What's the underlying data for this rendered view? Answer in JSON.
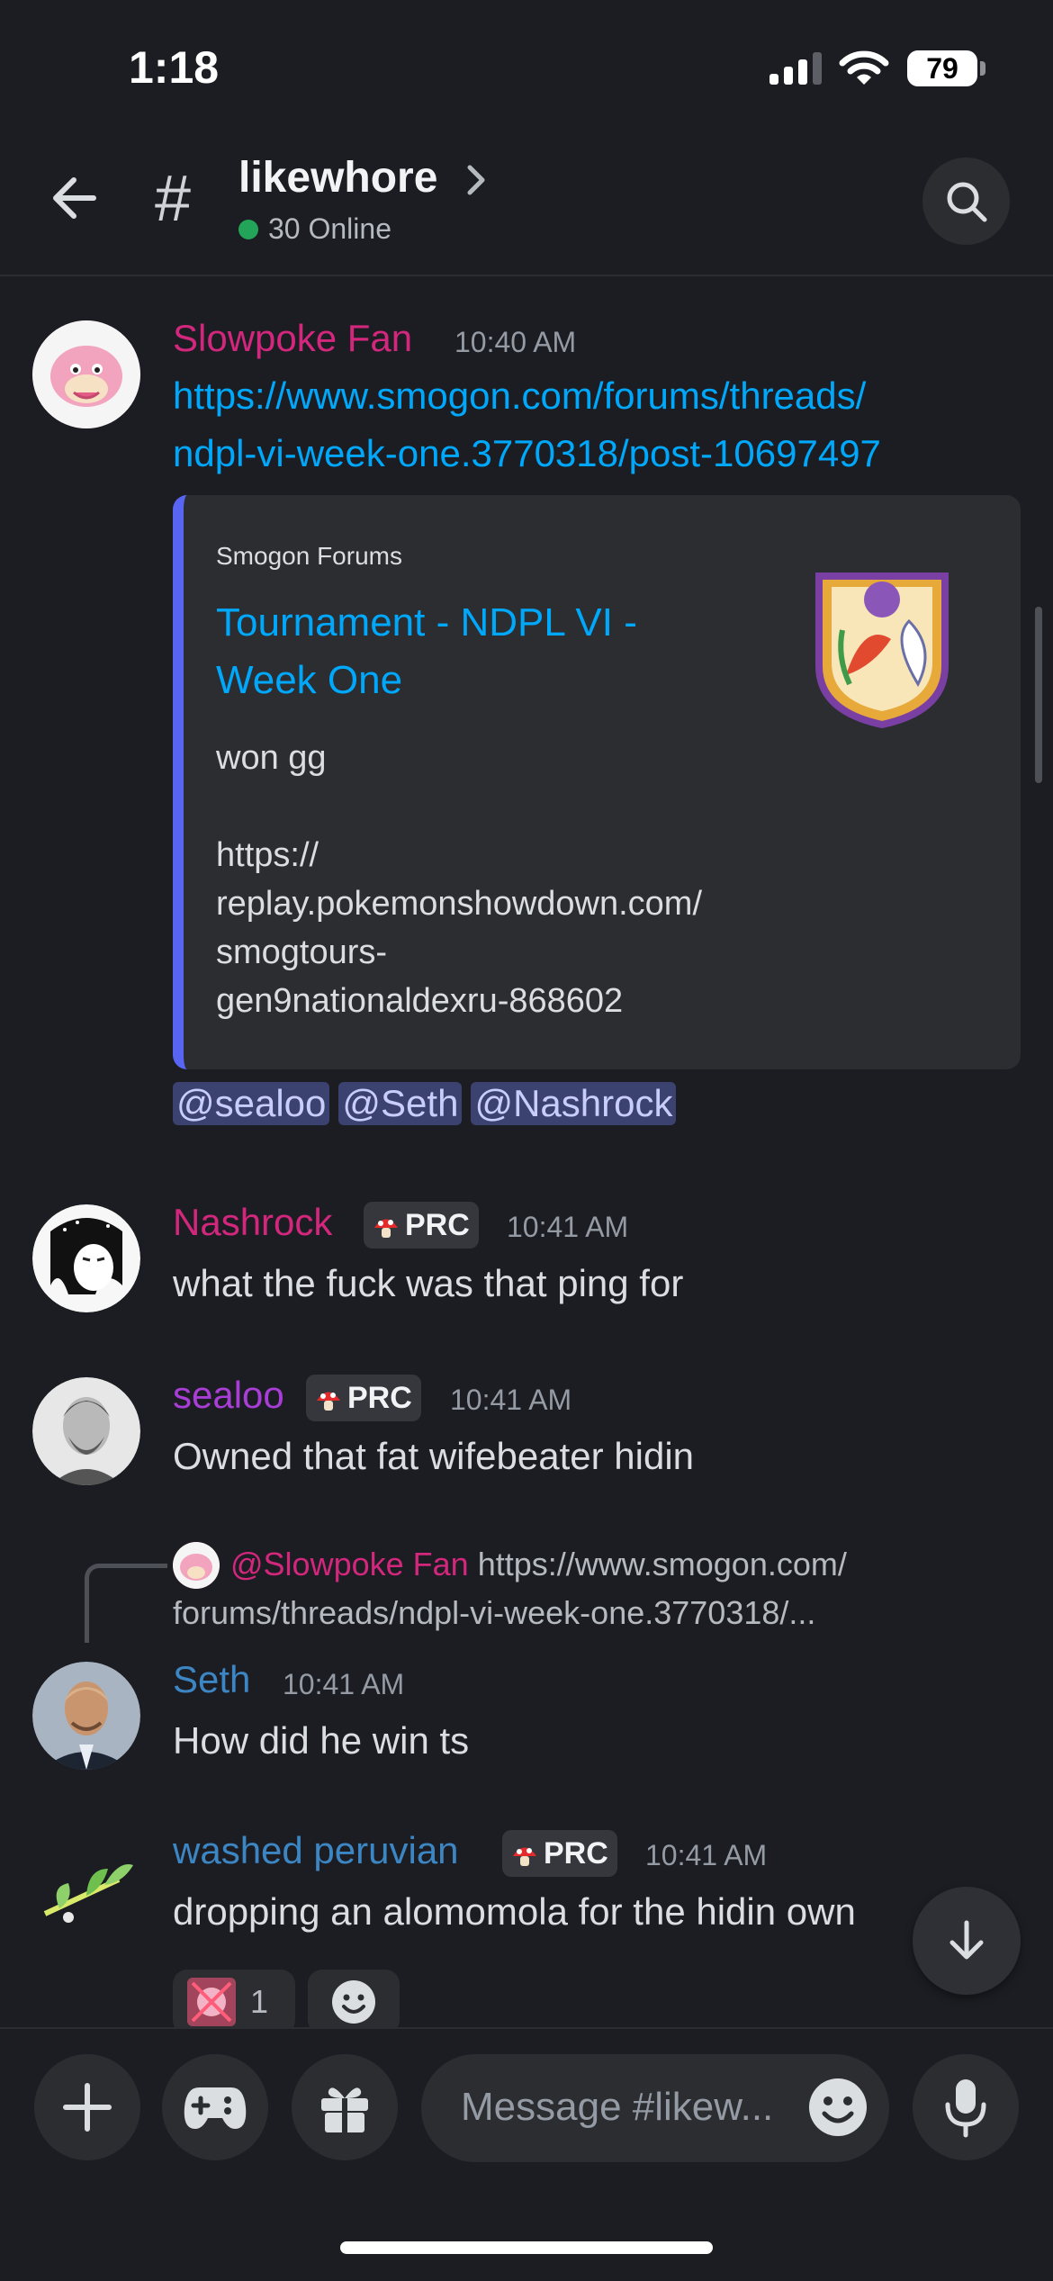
{
  "status_bar": {
    "time": "1:18",
    "battery": "79"
  },
  "header": {
    "channel_name": "likewhore",
    "online": "30 Online"
  },
  "messages": [
    {
      "username": "Slowpoke Fan",
      "username_color": "#d2277d",
      "time": "10:40 AM",
      "link_line1": "https://www.smogon.com/forums/threads/",
      "link_line2": "ndpl-vi-week-one.3770318/post-10697497",
      "embed": {
        "provider": "Smogon Forums",
        "title": "Tournament - NDPL VI - Week One",
        "description": "won gg\n\nhttps://\nreplay.pokemonshowdown.com/\nsmogtours-\ngen9nationaldexru-868602"
      },
      "mentions": [
        "@sealoo",
        "@Seth",
        "@Nashrock"
      ]
    },
    {
      "username": "Nashrock",
      "username_color": "#d2277d",
      "badge": "PRC",
      "time": "10:41 AM",
      "text": "what the fuck was that ping for"
    },
    {
      "username": "sealoo",
      "username_color": "#a83ed6",
      "badge": "PRC",
      "time": "10:41 AM",
      "text": "Owned that fat wifebeater hidin"
    },
    {
      "reply_to": "@Slowpoke Fan",
      "reply_preview_1": "https://www.smogon.com/",
      "reply_preview_2": "forums/threads/ndpl-vi-week-one.3770318/...",
      "username": "Seth",
      "username_color": "#3c86c4",
      "time": "10:41 AM",
      "text": "How did he win ts"
    },
    {
      "username": "washed peruvian",
      "username_color": "#3c86c4",
      "badge": "PRC",
      "time": "10:41 AM",
      "text": "dropping an alomomola for the hidin own",
      "reaction_count": "1"
    }
  ],
  "composer": {
    "placeholder": "Message #likew..."
  },
  "icons": [
    "back-arrow-icon",
    "hash-icon",
    "chevron-right-icon",
    "search-icon",
    "scroll-down-icon",
    "plus-icon",
    "gamepad-icon",
    "gift-icon",
    "emoji-icon",
    "microphone-icon"
  ]
}
